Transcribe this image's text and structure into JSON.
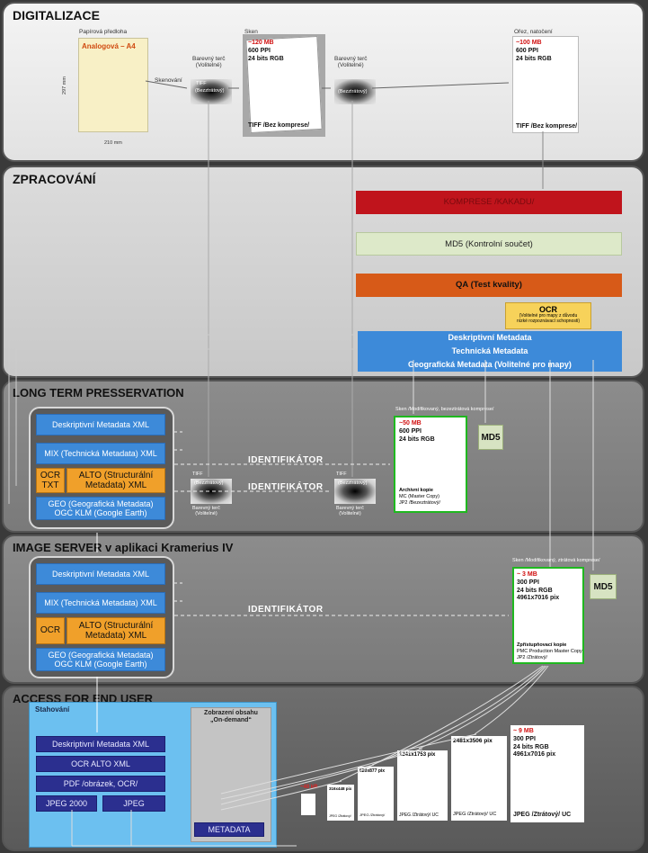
{
  "sections": {
    "digitalizace": "DIGITALIZACE",
    "zpracovani": "ZPRACOVÁNÍ",
    "ltp": "LONG TERM PRESSERVATION",
    "imageserver": "IMAGE SERVER v aplikaci Kramerius IV",
    "access": "ACCESS FOR END USER"
  },
  "digit": {
    "paper_caption": "Papírová předloha",
    "paper_label": "Analogová – A4",
    "dim_w": "210 mm",
    "dim_h": "297 mm",
    "scan_action": "Skenování",
    "target1_label": "Barevný terč\n(Volitelné)",
    "target1_inner": "TIFF",
    "target1_sub": "(Bezztrátový)",
    "scan_caption": "Sken",
    "scan_size": "~120 MB",
    "scan_ppi": "600 PPI",
    "scan_bits": "24 bits RGB",
    "scan_format": "TIFF /Bez komprese/",
    "target2_label": "Barevný terč\n(Volitelné)",
    "target2_sub": "(Bezztrátový)",
    "crop_caption": "Ořez, natočení",
    "crop_size": "~100 MB",
    "crop_ppi": "600 PPI",
    "crop_bits": "24 bits RGB",
    "crop_format": "TIFF /Bez komprese/"
  },
  "proc": {
    "kompres": "KOMPRESE /KAKADU/",
    "md5": "MD5 (Kontrolní součet)",
    "qa": "QA (Test kvality)",
    "ocr": "OCR",
    "ocr_note": "(Volitelné pro mapy z důvodu\nnízké rozpoznávací schopnosti)",
    "meta1": "Deskriptivní Metadata",
    "meta2": "Technická Metadata",
    "meta3": "Geografická Metadata (Volitelné pro mapy)"
  },
  "ltp": {
    "b1": "Deskriptivní Metadata XML",
    "b2": "MIX (Technická Metadata) XML",
    "ocr": "OCR\nTXT",
    "alto": "ALTO (Structurální\nMetadata) XML",
    "geo": "GEO (Geografická Metadata)\nOGC KLM (Google Earth)",
    "ident1": "IDENTIFIKÁTOR",
    "ident2": "IDENTIFIKÁTOR",
    "tiff_a": "TIFF",
    "tiff_a_sub": "(Bezztrátový)",
    "target_a": "Barevný terč\n(Volitelné)",
    "tiff_b": "TIFF",
    "tiff_b_sub": "(Bezztrátový)",
    "target_b": "Barevný terč\n(Volitelné)",
    "scan_caption": "Sken /Modifikovaný, bezeztrátová komprese/",
    "size": "~50 MB",
    "ppi": "600 PPI",
    "bits": "24 bits RGB",
    "archive1": "Archivní kopie",
    "archive2": "MC (Master Copy)",
    "archive3": "JP2 /Bezeztrátový/",
    "md5": "MD5"
  },
  "iserver": {
    "b1": "Deskriptivní Metadata XML",
    "b2": "MIX (Technická Metadata) XML",
    "ocr": "OCR",
    "alto": "ALTO (Structurální\nMetadata) XML",
    "geo": "GEO (Geografická Metadata)\nOGC KLM (Google Earth)",
    "ident": "IDENTIFIKÁTOR",
    "scan_caption": "Sken /Modifikovaný, ztrátová komprese/",
    "size": "~ 3 MB",
    "ppi": "300 PPI",
    "bits": "24 bits RGB",
    "pix": "4961x7016 pix",
    "copy1": "Zpřístupňovací kopie",
    "copy2": "PMC Production Master Copy",
    "copy3": "JP2 /Ztrátový/",
    "md5": "MD5"
  },
  "access": {
    "download": "Stahování",
    "ondemand": "Zobrazení obsahu\n„On-demand“",
    "d1": "Deskriptivní Metadata XML",
    "d2": "OCR ALTO XML",
    "d3": "PDF /obrázek, OCR/",
    "d4": "JPEG 2000",
    "d5": "JPEG",
    "metadata": "METADATA",
    "k40": "~40 kB",
    "t1": "316x448 pix",
    "t2": "620x877 pix",
    "t3": "1241x1753 pix",
    "t4": "2481x3506 pix",
    "f1": "JPEG /Ztrátový/",
    "f2": "JPEG /Ztrátový/",
    "f3": "JPEG /Ztrátový/ UC",
    "f4": "JPEG /Ztrátový/ UC",
    "big_size": "~ 9 MB",
    "big_ppi": "300 PPI",
    "big_bits": "24 bits RGB",
    "big_pix": "4961x7016 pix",
    "big_format": "JPEG /Ztrátový/ UC"
  },
  "colors": {
    "blue": "#3d8ad9",
    "orange": "#f0a02a",
    "red": "#c0141c",
    "dark_blue": "#2b2f8f",
    "green_border": "#1fb81f"
  }
}
